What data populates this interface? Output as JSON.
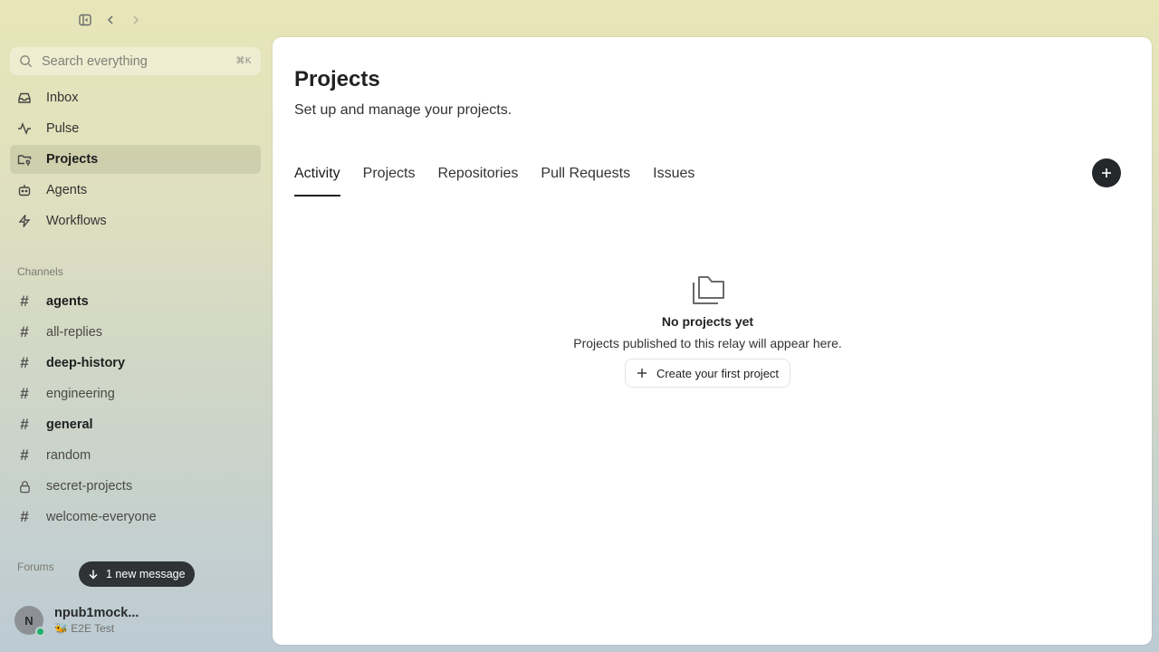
{
  "window": {
    "sidebar_toggle_icon": "sidebar-toggle-icon",
    "back_icon": "chevron-left-icon",
    "forward_icon": "chevron-right-icon"
  },
  "search": {
    "placeholder": "Search everything",
    "shortcut": "⌘K"
  },
  "nav": {
    "items": [
      {
        "label": "Inbox",
        "icon": "inbox-icon"
      },
      {
        "label": "Pulse",
        "icon": "activity-icon"
      },
      {
        "label": "Projects",
        "icon": "folder-git-icon",
        "active": true
      },
      {
        "label": "Agents",
        "icon": "bot-icon"
      },
      {
        "label": "Workflows",
        "icon": "zap-icon"
      }
    ]
  },
  "channels": {
    "heading": "Channels",
    "items": [
      {
        "name": "agents",
        "unread": true
      },
      {
        "name": "all-replies",
        "unread": false
      },
      {
        "name": "deep-history",
        "unread": true
      },
      {
        "name": "engineering",
        "unread": false
      },
      {
        "name": "general",
        "unread": true
      },
      {
        "name": "random",
        "unread": false
      },
      {
        "name": "secret-projects",
        "unread": false,
        "private": true
      },
      {
        "name": "welcome-everyone",
        "unread": false
      }
    ]
  },
  "forums": {
    "heading": "Forums"
  },
  "toast": {
    "label": "1 new message"
  },
  "user": {
    "initial": "N",
    "name": "npub1mock...",
    "status": "🐝 E2E Test",
    "presence_color": "#1db36b"
  },
  "page": {
    "title": "Projects",
    "subtitle": "Set up and manage your projects.",
    "tabs": [
      "Activity",
      "Projects",
      "Repositories",
      "Pull Requests",
      "Issues"
    ],
    "active_tab": "Activity"
  },
  "empty_state": {
    "title": "No projects yet",
    "description": "Projects published to this relay will appear here.",
    "button_label": "Create your first project"
  }
}
